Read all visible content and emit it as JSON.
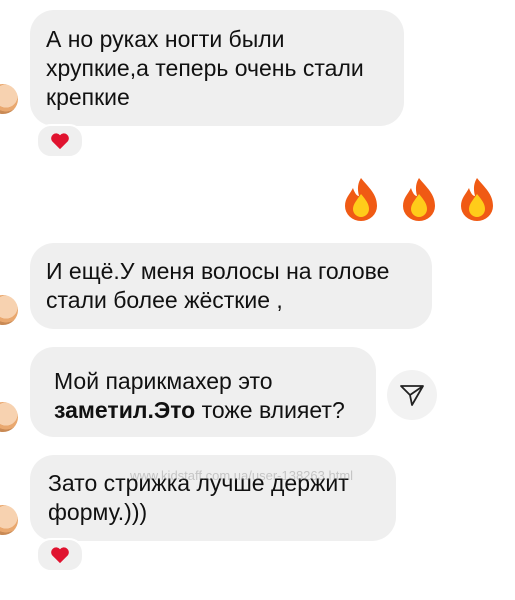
{
  "messages": [
    {
      "lines": [
        "А но руках ногти были",
        "хрупкие,а теперь очень стали",
        "крепкие"
      ],
      "reaction": "heart"
    },
    {
      "emojis": [
        "fire",
        "fire",
        "fire"
      ]
    },
    {
      "lines": [
        "И ещё.У меня волосы на голове",
        "стали более жёсткие ,"
      ]
    },
    {
      "line1": "Мой парикмахер это",
      "line2_bold": "заметил.Это",
      "line2_rest": " тоже влияет?"
    },
    {
      "lines": [
        "Зато стрижка  лучше держит",
        "форму.)))"
      ],
      "reaction": "heart"
    }
  ],
  "watermark": "www.kidstaff.com.ua/user-138263.html",
  "icons": {
    "reaction": "heart-icon",
    "emoji": "fire-emoji-icon",
    "share": "send-icon",
    "avatar": "avatar"
  },
  "colors": {
    "bubble": "#efefef",
    "heart": "#e0132f",
    "text": "#111111"
  }
}
